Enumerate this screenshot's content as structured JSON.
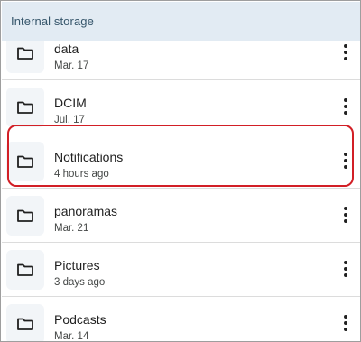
{
  "header": {
    "title": "Internal storage"
  },
  "folders": [
    {
      "name": "data",
      "date": "Mar. 17"
    },
    {
      "name": "DCIM",
      "date": "Jul. 17"
    },
    {
      "name": "Notifications",
      "date": "4 hours ago"
    },
    {
      "name": "panoramas",
      "date": "Mar. 21"
    },
    {
      "name": "Pictures",
      "date": "3 days ago"
    },
    {
      "name": "Podcasts",
      "date": "Mar. 14"
    }
  ],
  "colors": {
    "highlight": "#d21f26",
    "header_bg": "#e2ebf3"
  }
}
